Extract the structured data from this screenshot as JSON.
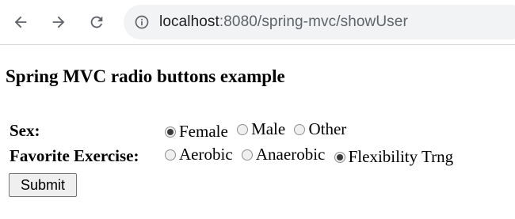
{
  "browser": {
    "url_host": "localhost",
    "url_rest": ":8080/spring-mvc/showUser"
  },
  "page": {
    "title": "Spring MVC radio buttons example"
  },
  "form": {
    "sex": {
      "label": "Sex:",
      "options": [
        {
          "label": "Female",
          "checked": true
        },
        {
          "label": "Male",
          "checked": false
        },
        {
          "label": "Other",
          "checked": false
        }
      ]
    },
    "exercise": {
      "label": "Favorite Exercise:",
      "options": [
        {
          "label": "Aerobic",
          "checked": false
        },
        {
          "label": "Anaerobic",
          "checked": false
        },
        {
          "label": "Flexibility Trng",
          "checked": true
        }
      ]
    },
    "submit_label": "Submit"
  }
}
